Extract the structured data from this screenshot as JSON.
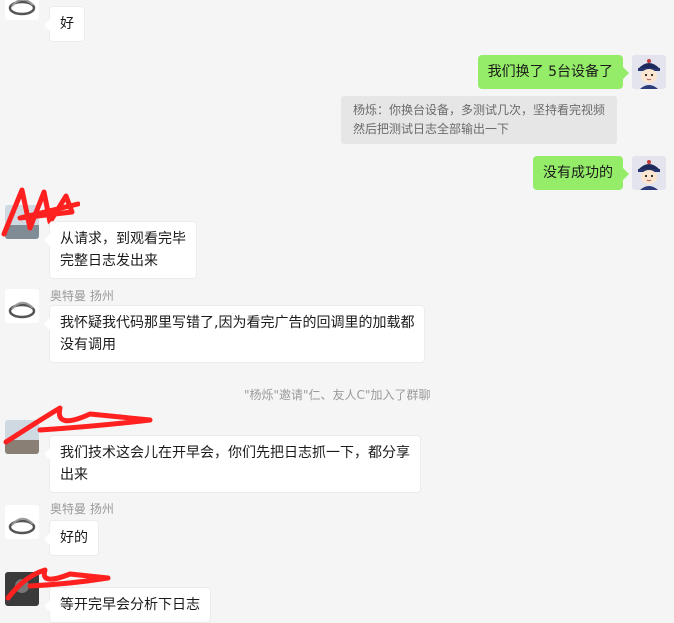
{
  "messages": {
    "m1": {
      "text": "好"
    },
    "m2": {
      "text": "我们换了 5台设备了"
    },
    "m2_quote": {
      "line1": "杨烁：你换台设备，多测试几次，坚持看完视频",
      "line2": "然后把测试日志全部输出一下"
    },
    "m3": {
      "text": "没有成功的"
    },
    "m4": {
      "line1": "从请求，到观看完毕",
      "line2": "完整日志发出来"
    },
    "m5": {
      "sender": "奥特曼 扬州",
      "line1": "我怀疑我代码那里写错了,因为看完广告的回调里的加载都",
      "line2": "没有调用"
    },
    "sys1": {
      "text": "\"杨烁\"邀请\"仁、友人C\"加入了群聊"
    },
    "m6": {
      "line1": "我们技术这会儿在开早会，你们先把日志抓一下，都分享",
      "line2": "出来"
    },
    "m7": {
      "sender": "奥特曼 扬州",
      "text": "好的"
    },
    "m8": {
      "text": "等开完早会分析下日志"
    }
  },
  "colors": {
    "background": "#f5f5f5",
    "bubble_self": "#95ec69",
    "bubble_other": "#ffffff",
    "redaction": "#ff2020"
  },
  "icons": {
    "logo_avatar": "silver-ring-logo",
    "self_avatar": "cartoon-qing-official-avatar",
    "photo_avatar": "photo-avatar"
  }
}
